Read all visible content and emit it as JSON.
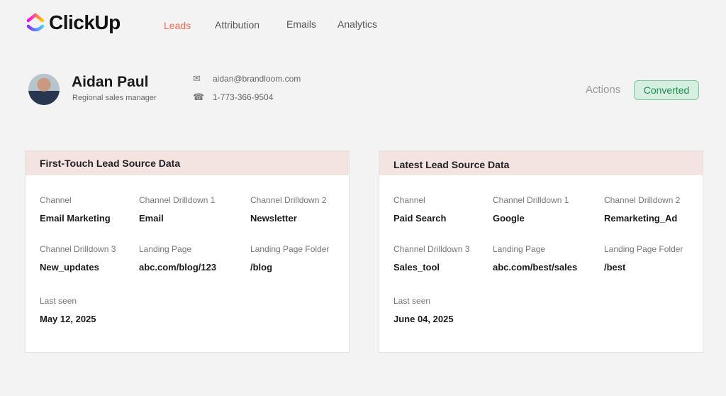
{
  "brand": {
    "name": "ClickUp"
  },
  "nav": [
    {
      "label": "Leads",
      "active": true
    },
    {
      "label": "Attribution"
    },
    {
      "label": "Emails"
    },
    {
      "label": "Analytics"
    }
  ],
  "profile": {
    "name": "Aidan Paul",
    "role": "Regional sales manager",
    "email": "aidan@brandloom.com",
    "phone": "1-773-366-9504",
    "icons": {
      "email": "envelope-icon",
      "phone": "phone-icon"
    }
  },
  "actions_label": "Actions",
  "status": {
    "label": "Converted",
    "color": "#1f8a4c"
  },
  "cards": [
    {
      "title": "First-Touch Lead Source Data",
      "fields": [
        {
          "label": "Channel",
          "value": "Email Marketing"
        },
        {
          "label": "Channel Drilldown 1",
          "value": "Email"
        },
        {
          "label": "Channel Drilldown 2",
          "value": "Newsletter"
        },
        {
          "label": "Channel Drilldown 3",
          "value": "New_updates"
        },
        {
          "label": "Landing Page",
          "value": "abc.com/blog/123"
        },
        {
          "label": "Landing Page Folder",
          "value": "/blog"
        },
        {
          "label": "Last seen",
          "value": "May 12, 2025"
        }
      ]
    },
    {
      "title": "Latest Lead Source Data",
      "fields": [
        {
          "label": "Channel",
          "value": "Paid Search"
        },
        {
          "label": "Channel Drilldown 1",
          "value": "Google"
        },
        {
          "label": "Channel Drilldown 2",
          "value": "Remarketing_Ad"
        },
        {
          "label": "Channel Drilldown 3",
          "value": "Sales_tool"
        },
        {
          "label": "Landing Page",
          "value": "abc.com/best/sales"
        },
        {
          "label": "Landing Page Folder",
          "value": "/best"
        },
        {
          "label": "Last seen",
          "value": "June 04, 2025"
        }
      ]
    }
  ]
}
